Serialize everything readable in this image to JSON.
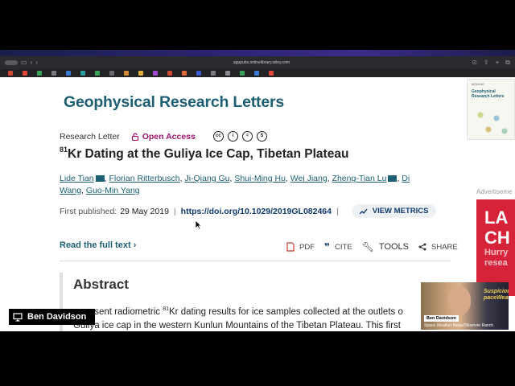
{
  "browser": {
    "url": "agupubs.onlinelibrary.wiley.com"
  },
  "page": {
    "journal_name": "Geophysical Research Letters",
    "article_type": "Research Letter",
    "open_access": "Open Access",
    "title_superscript": "81",
    "title_rest": "Kr Dating at the Guliya Ice Cap, Tibetan Plateau",
    "authors": [
      "Lide Tian",
      "Florian Ritterbusch",
      "Ji-Qiang Gu",
      "Shui-Ming Hu",
      "Wei Jiang",
      "Zheng-Tian Lu",
      "Di Wang",
      "Guo-Min Yang"
    ],
    "first_published_label": "First published:",
    "first_published_date": "29 May 2019",
    "doi": "https://doi.org/10.1029/2019GL082464",
    "view_metrics": "VIEW METRICS",
    "read_full_text": "Read the full text",
    "tools": {
      "pdf": "PDF",
      "cite": "CITE",
      "tools": "TOOLS",
      "share": "SHARE"
    },
    "abstract_heading": "Abstract",
    "abstract_line1_a": "e present radiometric ",
    "abstract_line1_sup": "81",
    "abstract_line1_b": "Kr dating results for ice samples collected at the outlets o",
    "abstract_line2": "Guliya ice cap in the western Kunlun Mountains of the Tibetan Plateau. This first"
  },
  "sidebar": {
    "cover_publisher": "AGU100",
    "cover_title": "Geophysical Research Letters",
    "ad_label": "Advertiseme",
    "ad_big": "LA CH",
    "ad_small": "Hurry resea"
  },
  "overlay": {
    "presenter_name": "Ben Davidson",
    "cam_name": "Ben Davidson",
    "cam_subtitle": "Space Weather News/Observer Ranch",
    "cam_sign": "Suspicious paceWeat"
  },
  "colors": {
    "journal": "#1d6073",
    "open_access": "#a2156d",
    "doi": "#0f3b6e",
    "ad": "#d6233a"
  }
}
